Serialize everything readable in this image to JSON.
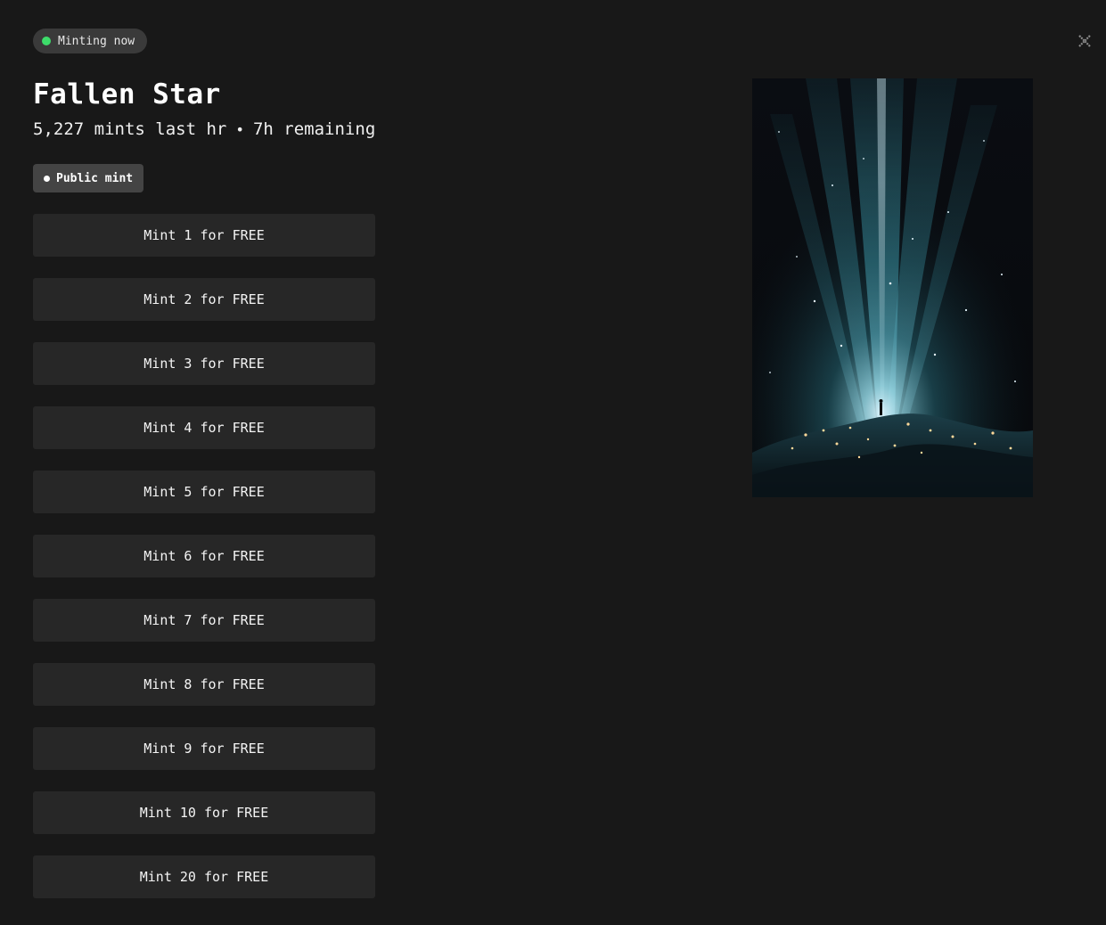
{
  "status": {
    "label": "Minting now",
    "dot_color": "#3ddc6a"
  },
  "close": {
    "icon": "close-icon"
  },
  "collection": {
    "title": "Fallen Star",
    "mints_last_hr": "5,227 mints last hr",
    "separator": "•",
    "remaining": "7h remaining"
  },
  "phase": {
    "label": "Public mint"
  },
  "mint_options": [
    {
      "label": "Mint 1 for FREE"
    },
    {
      "label": "Mint 2 for FREE"
    },
    {
      "label": "Mint 3 for FREE"
    },
    {
      "label": "Mint 4 for FREE"
    },
    {
      "label": "Mint 5 for FREE"
    },
    {
      "label": "Mint 6 for FREE"
    },
    {
      "label": "Mint 7 for FREE"
    },
    {
      "label": "Mint 8 for FREE"
    },
    {
      "label": "Mint 9 for FREE"
    },
    {
      "label": "Mint 10 for FREE"
    },
    {
      "label": "Mint 20 for FREE"
    }
  ],
  "colors": {
    "background": "#181818",
    "button_bg": "#272727",
    "pill_bg": "#3a3a3a",
    "tag_bg": "#444444"
  }
}
